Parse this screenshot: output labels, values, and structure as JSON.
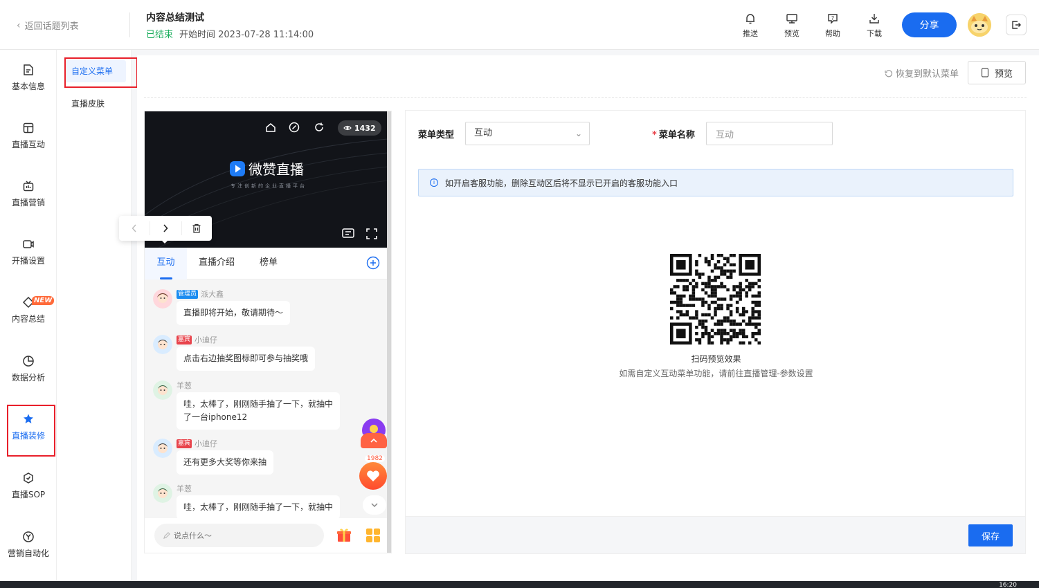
{
  "header": {
    "back_label": "返回话题列表",
    "title": "内容总结测试",
    "status": "已结束",
    "start_time": "开始时间 2023-07-28 11:14:00",
    "tools": [
      {
        "label": "推送",
        "icon": "bell-icon"
      },
      {
        "label": "预览",
        "icon": "monitor-icon"
      },
      {
        "label": "帮助",
        "icon": "help-icon"
      },
      {
        "label": "下载",
        "icon": "download-icon"
      }
    ],
    "share_label": "分享"
  },
  "leftnav": {
    "items": [
      {
        "label": "基本信息",
        "icon": "document-icon"
      },
      {
        "label": "直播互动",
        "icon": "layout-icon"
      },
      {
        "label": "直播营销",
        "icon": "marketing-icon"
      },
      {
        "label": "开播设置",
        "icon": "camera-icon"
      },
      {
        "label": "内容总结",
        "icon": "diamond-icon",
        "badge": "NEW"
      },
      {
        "label": "数据分析",
        "icon": "pie-chart-icon"
      },
      {
        "label": "直播装修",
        "icon": "decorate-icon",
        "active": true
      },
      {
        "label": "直播SOP",
        "icon": "sop-icon"
      },
      {
        "label": "营销自动化",
        "icon": "automation-icon"
      }
    ]
  },
  "subnav": {
    "items": [
      {
        "label": "自定义菜单",
        "active": true
      },
      {
        "label": "直播皮肤"
      }
    ]
  },
  "toolbar": {
    "restore_label": "恢复到默认菜单",
    "preview_label": "预览"
  },
  "phone": {
    "view_count": "1432",
    "brand_name": "微赞直播",
    "brand_tagline": "专注创新的企业直播平台",
    "tabs": [
      "互动",
      "直播介绍",
      "榜单"
    ],
    "messages": [
      {
        "role": "管理员",
        "role_type": "admin",
        "name": "派大鑫",
        "text": "直播即将开始，敬请期待～"
      },
      {
        "role": "嘉宾",
        "role_type": "guest",
        "name": "小迪仔",
        "text": "点击右边抽奖图标即可参与抽奖哦"
      },
      {
        "role": "",
        "role_type": "none",
        "name": "羊葱",
        "text_lines": [
          "哇，太棒了，刚刚随手抽了一下，就抽中",
          "了一台iphone12"
        ]
      },
      {
        "role": "嘉宾",
        "role_type": "guest",
        "name": "小迪仔",
        "text": "还有更多大奖等你来抽"
      },
      {
        "role": "",
        "role_type": "none",
        "name": "羊葱",
        "text": "哇，太棒了，刚刚随手抽了一下，就抽中"
      }
    ],
    "like_count": "1982",
    "input_placeholder": "说点什么～"
  },
  "form": {
    "menu_type_label": "菜单类型",
    "menu_type_value": "互动",
    "menu_name_label": "菜单名称",
    "menu_name_value": "互动",
    "info_text": "如开启客服功能，删除互动区后将不显示已开启的客服功能入口",
    "qr_caption": "扫码预览效果",
    "qr_hint": "如需自定义互动菜单功能，请前往直播管理-参数设置",
    "save_label": "保存"
  },
  "taskbar": {
    "clock": "16:20"
  },
  "colors": {
    "accent": "#1a6cf0",
    "ended": "#1aad5c",
    "highlight_box": "#e81f2a"
  }
}
